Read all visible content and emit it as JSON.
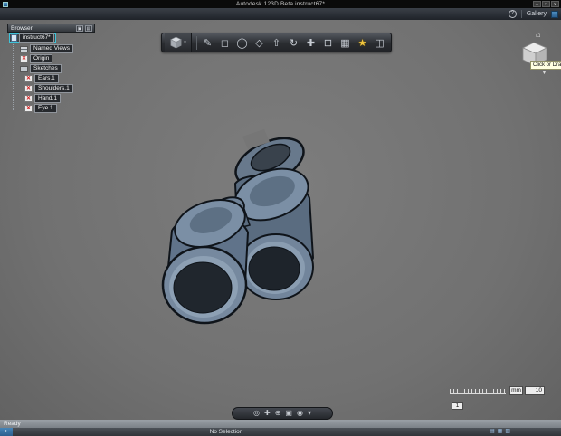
{
  "window": {
    "title": "Autodesk 123D Beta    instruct67*",
    "controls": {
      "minimize": "─",
      "maximize": "□",
      "close": "✕"
    }
  },
  "menubar": {
    "help": "?",
    "gallery": "Gallery"
  },
  "browser": {
    "header": "Browser",
    "hidden_glyph": "✕",
    "items": [
      {
        "label": "instruct67*"
      },
      {
        "label": "Named Views"
      },
      {
        "label": "Origin"
      },
      {
        "label": "Sketches"
      },
      {
        "label": "Ears.1"
      },
      {
        "label": "Shoulders.1"
      },
      {
        "label": "Hand.1"
      },
      {
        "label": "Eye.1"
      }
    ]
  },
  "toolbar": {
    "menu_caret": "▾",
    "tools": [
      {
        "name": "sketch",
        "glyph": "✎"
      },
      {
        "name": "primitive-box",
        "glyph": "◻"
      },
      {
        "name": "primitive-sphere",
        "glyph": "◯"
      },
      {
        "name": "primitive-cone",
        "glyph": "◇"
      },
      {
        "name": "extrude",
        "glyph": "⇧"
      },
      {
        "name": "revolve",
        "glyph": "↻"
      },
      {
        "name": "move",
        "glyph": "✚"
      },
      {
        "name": "pattern",
        "glyph": "⊞"
      },
      {
        "name": "combine",
        "glyph": "▦"
      },
      {
        "name": "favorites",
        "glyph": "★"
      },
      {
        "name": "materials",
        "glyph": "◫"
      }
    ]
  },
  "viewcube": {
    "home_glyph": "⌂",
    "tooltip": "Click or Drag",
    "chevron": "▼"
  },
  "scale": {
    "unit": "mm",
    "value": "10",
    "multiplier": "1"
  },
  "nav": {
    "tools": [
      {
        "name": "orbit",
        "glyph": "◎"
      },
      {
        "name": "pan",
        "glyph": "✚"
      },
      {
        "name": "zoom",
        "glyph": "⊕"
      },
      {
        "name": "fit-view",
        "glyph": "▣"
      },
      {
        "name": "look-at",
        "glyph": "◉"
      },
      {
        "name": "more",
        "glyph": "▾"
      }
    ]
  },
  "statusbar": {
    "ready": "Ready",
    "selection": "No Selection"
  }
}
